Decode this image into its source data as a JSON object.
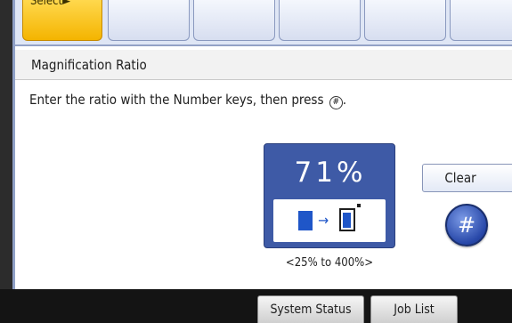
{
  "tabs": [
    {
      "label": "Select►",
      "selected": true
    },
    {
      "label": "",
      "selected": false
    },
    {
      "label": "",
      "selected": false
    },
    {
      "label": "",
      "selected": false
    },
    {
      "label": "",
      "selected": false
    },
    {
      "label": "",
      "selected": false
    }
  ],
  "header": {
    "title": "Magnification Ratio"
  },
  "instruction": {
    "text": "Enter the ratio with the Number keys, then press",
    "suffix": "."
  },
  "ratio": {
    "value": "71%",
    "range": "<25% to 400%>"
  },
  "actions": {
    "clear_label": "Clear",
    "hash_label": "#"
  },
  "footer": {
    "system_status": "System Status",
    "job_list": "Job List"
  },
  "colors": {
    "accent_blue": "#3e5aa6",
    "selected_tab": "#f4b400"
  }
}
